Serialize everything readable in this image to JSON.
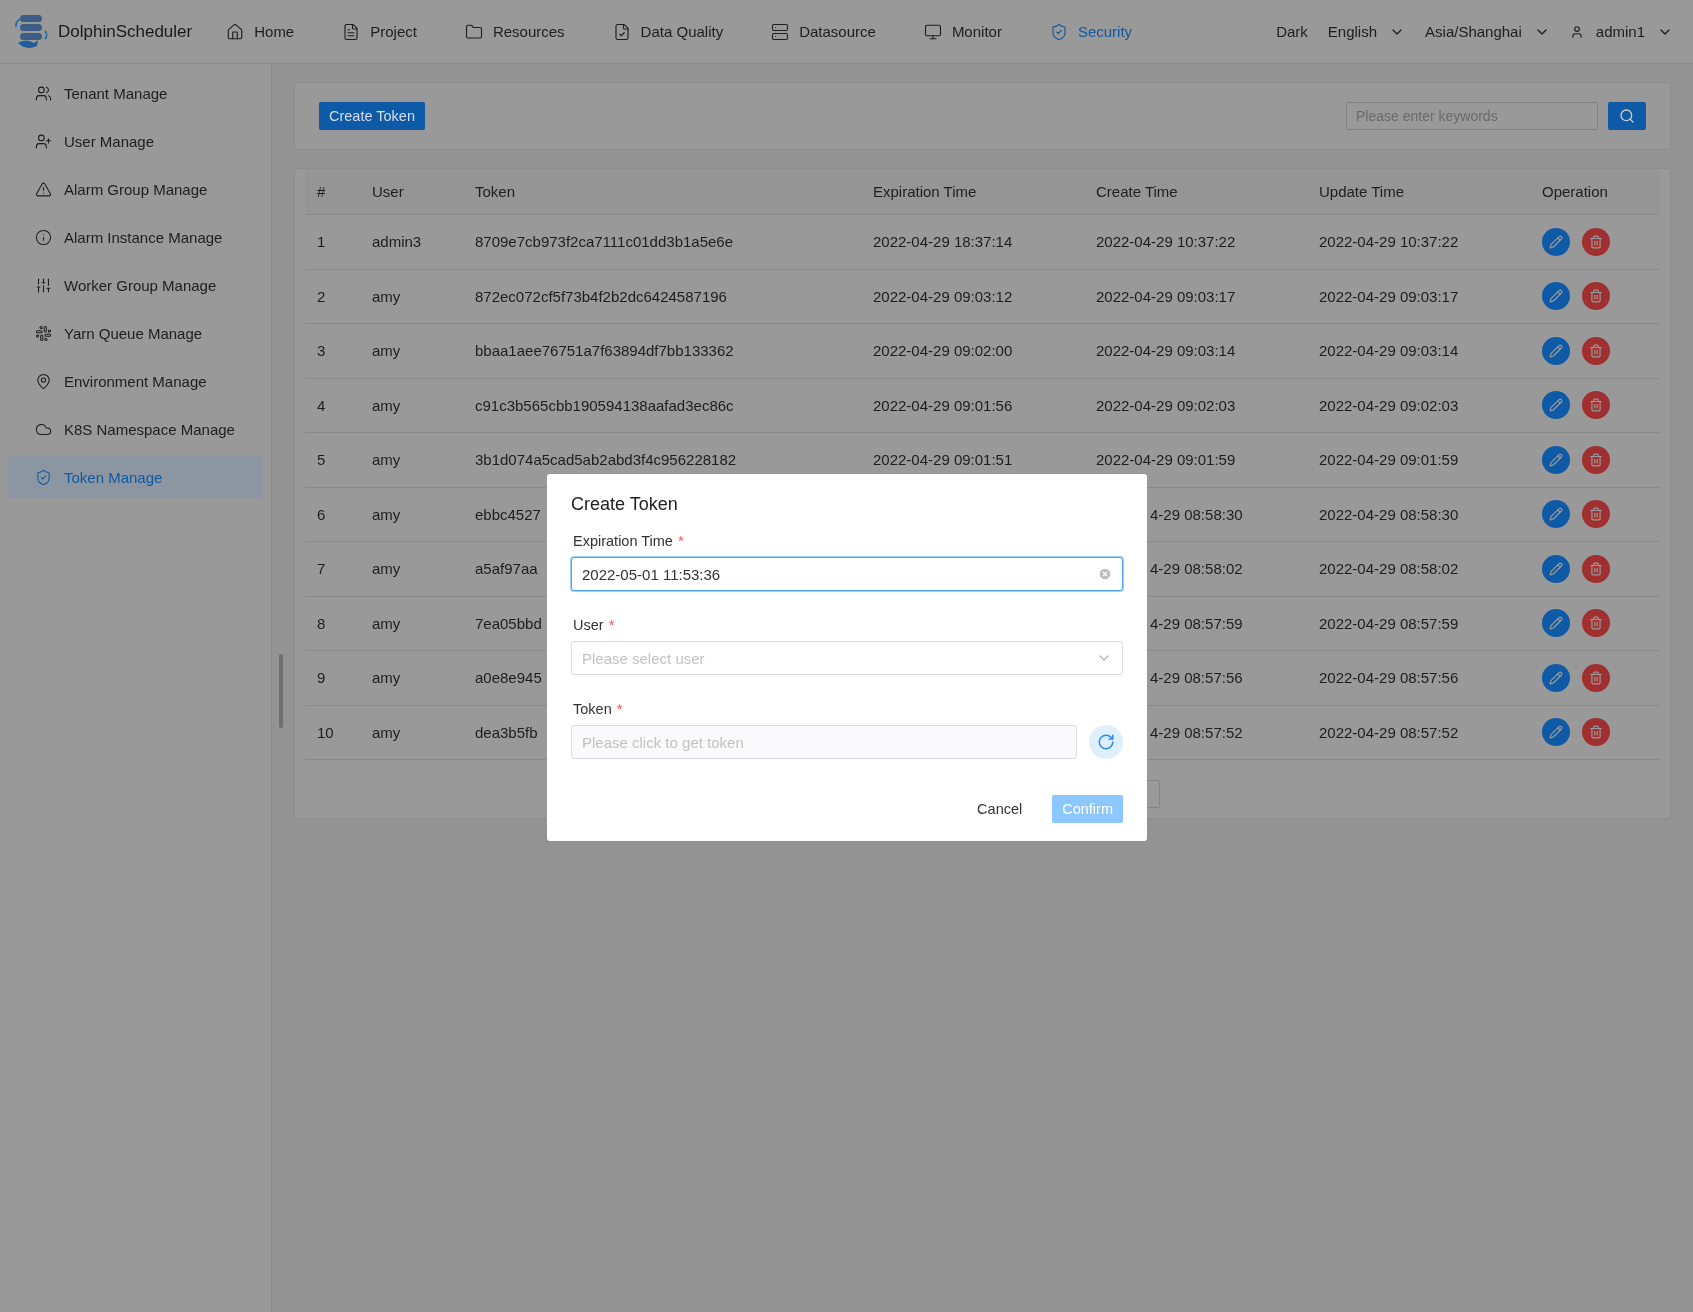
{
  "header": {
    "brand": "DolphinScheduler",
    "nav": [
      {
        "label": "Home",
        "selected": false
      },
      {
        "label": "Project",
        "selected": false
      },
      {
        "label": "Resources",
        "selected": false
      },
      {
        "label": "Data Quality",
        "selected": false
      },
      {
        "label": "Datasource",
        "selected": false
      },
      {
        "label": "Monitor",
        "selected": false
      },
      {
        "label": "Security",
        "selected": true
      }
    ],
    "theme": "Dark",
    "language": "English",
    "timezone": "Asia/Shanghai",
    "user": "admin1"
  },
  "sidebar": {
    "items": [
      {
        "label": "Tenant Manage",
        "selected": false
      },
      {
        "label": "User Manage",
        "selected": false
      },
      {
        "label": "Alarm Group Manage",
        "selected": false
      },
      {
        "label": "Alarm Instance Manage",
        "selected": false
      },
      {
        "label": "Worker Group Manage",
        "selected": false
      },
      {
        "label": "Yarn Queue Manage",
        "selected": false
      },
      {
        "label": "Environment Manage",
        "selected": false
      },
      {
        "label": "K8S Namespace Manage",
        "selected": false
      },
      {
        "label": "Token Manage",
        "selected": true
      }
    ]
  },
  "toolbar": {
    "create_button": "Create Token",
    "search": {
      "placeholder": "Please enter keywords"
    }
  },
  "table": {
    "columns": [
      "#",
      "User",
      "Token",
      "Expiration Time",
      "Create Time",
      "Update Time",
      "Operation"
    ],
    "rows": [
      {
        "index": "1",
        "user": "admin3",
        "token": "8709e7cb973f2ca7111c01dd3b1a5e6e",
        "expiration_time": "2022-04-29 18:37:14",
        "create_time": "2022-04-29 10:37:22",
        "update_time": "2022-04-29 10:37:22",
        "covered": false
      },
      {
        "index": "2",
        "user": "amy",
        "token": "872ec072cf5f73b4f2b2dc6424587196",
        "expiration_time": "2022-04-29 09:03:12",
        "create_time": "2022-04-29 09:03:17",
        "update_time": "2022-04-29 09:03:17",
        "covered": false
      },
      {
        "index": "3",
        "user": "amy",
        "token": "bbaa1aee76751a7f63894df7bb133362",
        "expiration_time": "2022-04-29 09:02:00",
        "create_time": "2022-04-29 09:03:14",
        "update_time": "2022-04-29 09:03:14",
        "covered": false
      },
      {
        "index": "4",
        "user": "amy",
        "token": "c91c3b565cbb190594138aafad3ec86c",
        "expiration_time": "2022-04-29 09:01:56",
        "create_time": "2022-04-29 09:02:03",
        "update_time": "2022-04-29 09:02:03",
        "covered": false
      },
      {
        "index": "5",
        "user": "amy",
        "token": "3b1d074a5cad5ab2abd3f4c956228182",
        "expiration_time": "2022-04-29 09:01:51",
        "create_time": "2022-04-29 09:01:59",
        "update_time": "2022-04-29 09:01:59",
        "covered": false
      },
      {
        "index": "6",
        "user": "amy",
        "token": "ebbc4527",
        "create_time": "4-29 08:58:30",
        "update_time": "2022-04-29 08:58:30",
        "covered": true
      },
      {
        "index": "7",
        "user": "amy",
        "token": "a5af97aa",
        "create_time": "4-29 08:58:02",
        "update_time": "2022-04-29 08:58:02",
        "covered": true
      },
      {
        "index": "8",
        "user": "amy",
        "token": "7ea05bbd",
        "create_time": "4-29 08:57:59",
        "update_time": "2022-04-29 08:57:59",
        "covered": true
      },
      {
        "index": "9",
        "user": "amy",
        "token": "a0e8e945",
        "create_time": "4-29 08:57:56",
        "update_time": "2022-04-29 08:57:56",
        "covered": true
      },
      {
        "index": "10",
        "user": "amy",
        "token": "dea3b5fb",
        "create_time": "4-29 08:57:52",
        "update_time": "2022-04-29 08:57:52",
        "covered": true
      }
    ]
  },
  "dialog": {
    "title": "Create Token",
    "fields": [
      {
        "kind": "date",
        "label": "Expiration Time",
        "required_mark": "*",
        "value": "2022-05-01 11:53:36",
        "focused": true
      },
      {
        "kind": "select",
        "label": "User",
        "required_mark": "*",
        "placeholder": "Please select user",
        "focused": false
      },
      {
        "kind": "token",
        "label": "Token",
        "required_mark": "*",
        "placeholder": "Please click to get token",
        "focused": false
      }
    ],
    "buttons": [
      {
        "kind": "text",
        "label": "Cancel",
        "disabled": false
      },
      {
        "kind": "primary",
        "label": "Confirm",
        "disabled": true
      }
    ]
  }
}
